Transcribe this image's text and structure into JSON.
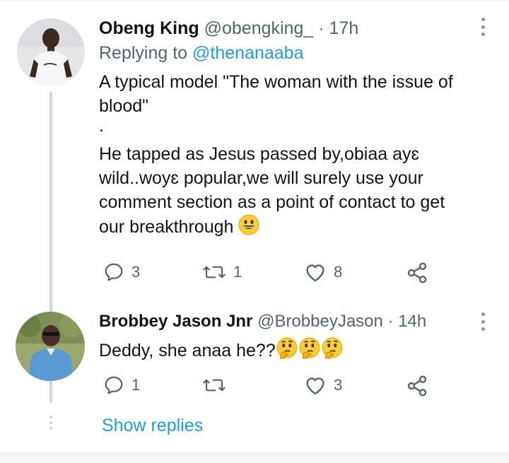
{
  "tweets": [
    {
      "name": "Obeng King",
      "handle": "@obengking_",
      "time": "· 17h",
      "replying_prefix": "Replying to ",
      "replying_to": "@thenanaaba",
      "lines": [
        "A typical model \"The woman with the issue of",
        "blood\"",
        ".",
        "He tapped as Jesus passed by,obiaa ayɛ",
        "wild..woyɛ popular,we will surely use your",
        "comment section as a point of contact to get",
        "our breakthrough"
      ],
      "reply_count": "3",
      "retweet_count": "1",
      "like_count": "8",
      "emoji": "grinning-face"
    },
    {
      "name": "Brobbey Jason Jnr",
      "handle": "@BrobbeyJason",
      "time": "· 14h",
      "text": "Deddy, she anaa he??",
      "reply_count": "1",
      "retweet_count": "",
      "like_count": "3",
      "emoji": "thinking-face"
    }
  ],
  "show_replies_label": "Show replies",
  "colors": {
    "accent": "#1d9bf0",
    "secondary_text": "#536471",
    "thread_line": "#cfd9de"
  }
}
